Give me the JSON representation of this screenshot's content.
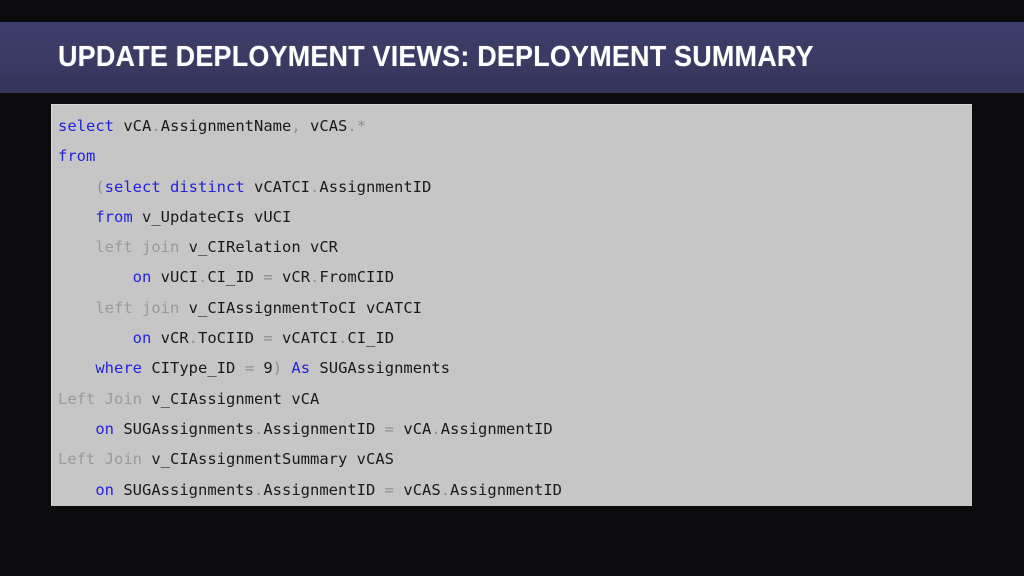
{
  "slide": {
    "background_color": "#0c0c0e",
    "title_band_color": "#3b3b67",
    "code_panel_color": "#c6c6c6"
  },
  "header": {
    "title": "UPDATE DEPLOYMENT VIEWS: DEPLOYMENT SUMMARY"
  },
  "colors": {
    "keyword": "#2323dd",
    "gray_keyword": "#9a9a9a",
    "identifier": "#1a1a1a",
    "punctuation": "#8e8e8e",
    "panel_background": "#c6c6c6",
    "band_background": "#3b3b67",
    "slide_background": "#0c0c0e",
    "title_text": "#ffffff"
  },
  "code": {
    "language": "sql",
    "plain_text": "select vCA.AssignmentName, vCAS.*\nfrom\n    (select distinct vCATCI.AssignmentID\n    from v_UpdateCIs vUCI\n    left join v_CIRelation vCR\n        on vUCI.CI_ID = vCR.FromCIID\n    left join v_CIAssignmentToCI vCATCI\n        on vCR.ToCIID = vCATCI.CI_ID\n    where CIType_ID = 9) As SUGAssignments\nLeft Join v_CIAssignment vCA\n    on SUGAssignments.AssignmentID = vCA.AssignmentID\nLeft Join v_CIAssignmentSummary vCAS\n    on SUGAssignments.AssignmentID = vCAS.AssignmentID",
    "lines": [
      {
        "indent": 0,
        "tokens": [
          {
            "t": "select",
            "c": "kw"
          },
          {
            "t": " ",
            "c": "ws"
          },
          {
            "t": "vCA",
            "c": "id"
          },
          {
            "t": ".",
            "c": "punc"
          },
          {
            "t": "AssignmentName",
            "c": "id"
          },
          {
            "t": ",",
            "c": "punc"
          },
          {
            "t": " ",
            "c": "ws"
          },
          {
            "t": "vCAS",
            "c": "id"
          },
          {
            "t": ".",
            "c": "punc"
          },
          {
            "t": "*",
            "c": "punc"
          }
        ]
      },
      {
        "indent": 0,
        "tokens": [
          {
            "t": "from",
            "c": "kw"
          }
        ]
      },
      {
        "indent": 4,
        "tokens": [
          {
            "t": "(",
            "c": "punc"
          },
          {
            "t": "select",
            "c": "kw"
          },
          {
            "t": " ",
            "c": "ws"
          },
          {
            "t": "distinct",
            "c": "kw"
          },
          {
            "t": " ",
            "c": "ws"
          },
          {
            "t": "vCATCI",
            "c": "id"
          },
          {
            "t": ".",
            "c": "punc"
          },
          {
            "t": "AssignmentID",
            "c": "id"
          }
        ]
      },
      {
        "indent": 4,
        "tokens": [
          {
            "t": "from",
            "c": "kw"
          },
          {
            "t": " ",
            "c": "ws"
          },
          {
            "t": "v_UpdateCIs",
            "c": "id"
          },
          {
            "t": " ",
            "c": "ws"
          },
          {
            "t": "vUCI",
            "c": "id"
          }
        ]
      },
      {
        "indent": 4,
        "tokens": [
          {
            "t": "left join",
            "c": "gray"
          },
          {
            "t": " ",
            "c": "ws"
          },
          {
            "t": "v_CIRelation",
            "c": "id"
          },
          {
            "t": " ",
            "c": "ws"
          },
          {
            "t": "vCR",
            "c": "id"
          }
        ]
      },
      {
        "indent": 8,
        "tokens": [
          {
            "t": "on",
            "c": "kw"
          },
          {
            "t": " ",
            "c": "ws"
          },
          {
            "t": "vUCI",
            "c": "id"
          },
          {
            "t": ".",
            "c": "punc"
          },
          {
            "t": "CI_ID",
            "c": "id"
          },
          {
            "t": " ",
            "c": "ws"
          },
          {
            "t": "=",
            "c": "punc"
          },
          {
            "t": " ",
            "c": "ws"
          },
          {
            "t": "vCR",
            "c": "id"
          },
          {
            "t": ".",
            "c": "punc"
          },
          {
            "t": "FromCIID",
            "c": "id"
          }
        ]
      },
      {
        "indent": 4,
        "tokens": [
          {
            "t": "left join",
            "c": "gray"
          },
          {
            "t": " ",
            "c": "ws"
          },
          {
            "t": "v_CIAssignmentToCI",
            "c": "id"
          },
          {
            "t": " ",
            "c": "ws"
          },
          {
            "t": "vCATCI",
            "c": "id"
          }
        ]
      },
      {
        "indent": 8,
        "tokens": [
          {
            "t": "on",
            "c": "kw"
          },
          {
            "t": " ",
            "c": "ws"
          },
          {
            "t": "vCR",
            "c": "id"
          },
          {
            "t": ".",
            "c": "punc"
          },
          {
            "t": "ToCIID",
            "c": "id"
          },
          {
            "t": " ",
            "c": "ws"
          },
          {
            "t": "=",
            "c": "punc"
          },
          {
            "t": " ",
            "c": "ws"
          },
          {
            "t": "vCATCI",
            "c": "id"
          },
          {
            "t": ".",
            "c": "punc"
          },
          {
            "t": "CI_ID",
            "c": "id"
          }
        ]
      },
      {
        "indent": 4,
        "tokens": [
          {
            "t": "where",
            "c": "kw"
          },
          {
            "t": " ",
            "c": "ws"
          },
          {
            "t": "CIType_ID",
            "c": "id"
          },
          {
            "t": " ",
            "c": "ws"
          },
          {
            "t": "=",
            "c": "punc"
          },
          {
            "t": " ",
            "c": "ws"
          },
          {
            "t": "9",
            "c": "num"
          },
          {
            "t": ")",
            "c": "punc"
          },
          {
            "t": " ",
            "c": "ws"
          },
          {
            "t": "As",
            "c": "kw"
          },
          {
            "t": " ",
            "c": "ws"
          },
          {
            "t": "SUGAssignments",
            "c": "id"
          }
        ]
      },
      {
        "indent": 0,
        "tokens": [
          {
            "t": "Left Join",
            "c": "gray"
          },
          {
            "t": " ",
            "c": "ws"
          },
          {
            "t": "v_CIAssignment",
            "c": "id"
          },
          {
            "t": " ",
            "c": "ws"
          },
          {
            "t": "vCA",
            "c": "id"
          }
        ]
      },
      {
        "indent": 4,
        "tokens": [
          {
            "t": "on",
            "c": "kw"
          },
          {
            "t": " ",
            "c": "ws"
          },
          {
            "t": "SUGAssignments",
            "c": "id"
          },
          {
            "t": ".",
            "c": "punc"
          },
          {
            "t": "AssignmentID",
            "c": "id"
          },
          {
            "t": " ",
            "c": "ws"
          },
          {
            "t": "=",
            "c": "punc"
          },
          {
            "t": " ",
            "c": "ws"
          },
          {
            "t": "vCA",
            "c": "id"
          },
          {
            "t": ".",
            "c": "punc"
          },
          {
            "t": "AssignmentID",
            "c": "id"
          }
        ]
      },
      {
        "indent": 0,
        "tokens": [
          {
            "t": "Left Join",
            "c": "gray"
          },
          {
            "t": " ",
            "c": "ws"
          },
          {
            "t": "v_CIAssignmentSummary",
            "c": "id"
          },
          {
            "t": " ",
            "c": "ws"
          },
          {
            "t": "vCAS",
            "c": "id"
          }
        ]
      },
      {
        "indent": 4,
        "tokens": [
          {
            "t": "on",
            "c": "kw"
          },
          {
            "t": " ",
            "c": "ws"
          },
          {
            "t": "SUGAssignments",
            "c": "id"
          },
          {
            "t": ".",
            "c": "punc"
          },
          {
            "t": "AssignmentID",
            "c": "id"
          },
          {
            "t": " ",
            "c": "ws"
          },
          {
            "t": "=",
            "c": "punc"
          },
          {
            "t": " ",
            "c": "ws"
          },
          {
            "t": "vCAS",
            "c": "id"
          },
          {
            "t": ".",
            "c": "punc"
          },
          {
            "t": "AssignmentID",
            "c": "id"
          }
        ]
      }
    ]
  }
}
